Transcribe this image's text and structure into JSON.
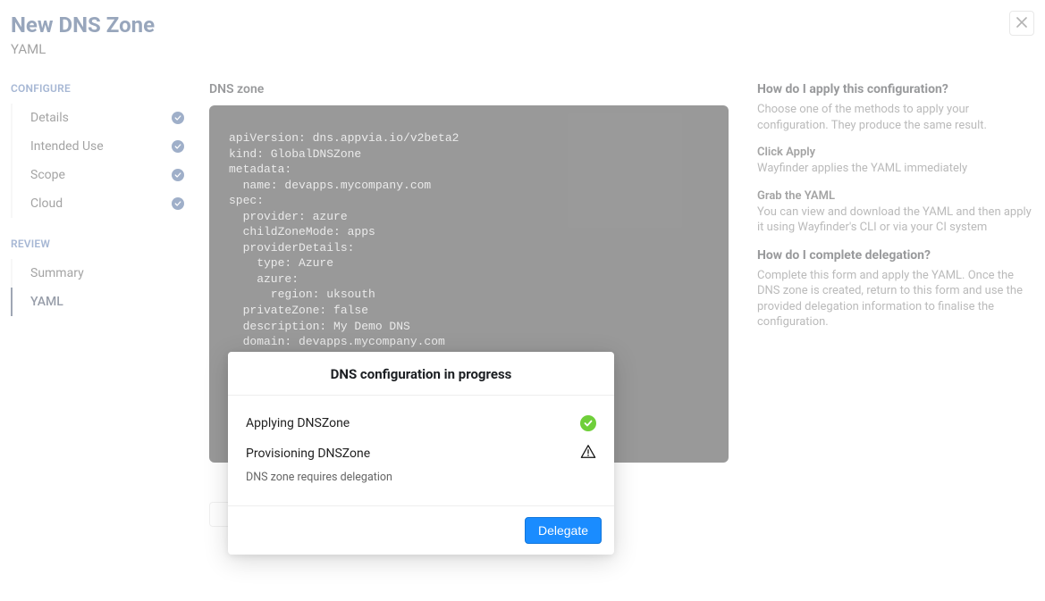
{
  "header": {
    "title": "New DNS Zone",
    "subtitle": "YAML"
  },
  "sidebar": {
    "configure_label": "CONFIGURE",
    "review_label": "REVIEW",
    "configure_items": [
      {
        "label": "Details",
        "checked": true
      },
      {
        "label": "Intended Use",
        "checked": true
      },
      {
        "label": "Scope",
        "checked": true
      },
      {
        "label": "Cloud",
        "checked": true
      }
    ],
    "review_items": [
      {
        "label": "Summary",
        "active": false
      },
      {
        "label": "YAML",
        "active": true
      }
    ]
  },
  "main": {
    "section_label": "DNS zone",
    "yaml": "apiVersion: dns.appvia.io/v2beta2\nkind: GlobalDNSZone\nmetadata:\n  name: devapps.mycompany.com\nspec:\n  provider: azure\n  childZoneMode: apps\n  providerDetails:\n    type: Azure\n    azure:\n      region: uksouth\n  privateZone: false\n  description: My Demo DNS\n  domain: devapps.mycompany.com"
  },
  "help": {
    "h1": "How do I apply this configuration?",
    "h1_text": "Choose one of the methods to apply your configuration. They produce the same result.",
    "s1_title": "Click Apply",
    "s1_text": "Wayfinder applies the YAML immediately",
    "s2_title": "Grab the YAML",
    "s2_text": "You can view and download the YAML and then apply it using Wayfinder's CLI or via your CI system",
    "h2": "How do I complete delegation?",
    "h2_text": "Complete this form and apply the YAML. Once the DNS zone is created, return to this form and use the provided delegation information to finalise the configuration."
  },
  "modal": {
    "title": "DNS configuration in progress",
    "row1_label": "Applying DNSZone",
    "row2_label": "Provisioning DNSZone",
    "row2_note": "DNS zone requires delegation",
    "delegate_label": "Delegate"
  }
}
